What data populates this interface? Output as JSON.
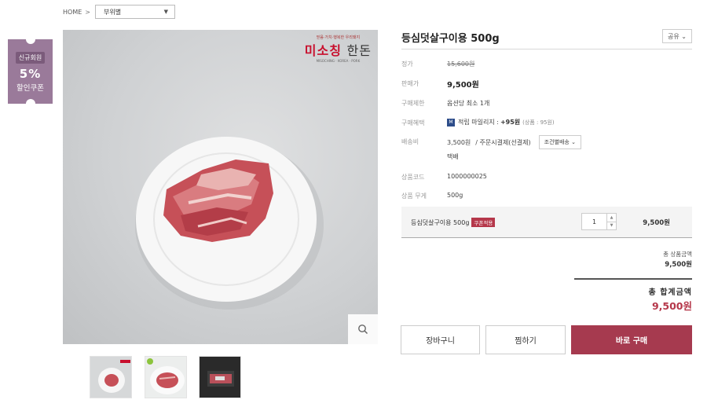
{
  "breadcrumb": {
    "home": "HOME",
    "separator": ">",
    "category": "부위별"
  },
  "coupon": {
    "tag": "신규회원",
    "percent": "5%",
    "text": "할인쿠폰"
  },
  "logo": {
    "small": "믿음·가치·행복한 우리돼지",
    "brand_red": "미소칭",
    "brand_black": "한돈",
    "english": "MISOCHING · KOREA · PORK"
  },
  "product": {
    "title": "등심덧살구이용 500g",
    "share_label": "공유 ⌄",
    "rows": {
      "list_price_label": "정가",
      "list_price": "15,600원",
      "sale_price_label": "판매가",
      "sale_price": "9,500원",
      "limit_label": "구매제한",
      "limit": "옵션당 최소 1개",
      "benefit_label": "구매혜택",
      "benefit_badge": "M",
      "benefit_text": "적립 마일리지 :",
      "benefit_points": "+95원",
      "benefit_note": "(상품 : 95원)",
      "shipping_label": "배송비",
      "shipping_fee": "3,500원",
      "shipping_method": "/ 주문시결제(선결제)",
      "shipping_btn": "조건별배송 ⌄",
      "shipping_type": "택배",
      "code_label": "상품코드",
      "code": "1000000025",
      "weight_label": "상품 무게",
      "weight": "500g"
    },
    "option": {
      "name": "등심덧살구이용 500g",
      "badge": "쿠폰적용",
      "quantity": "1",
      "price": "9,500원"
    },
    "summary": {
      "label": "총 상품금액",
      "value": "9,500원"
    },
    "total": {
      "label": "총 합계금액",
      "value": "9,500원"
    },
    "buttons": {
      "cart": "장바구니",
      "wish": "찜하기",
      "buy": "바로 구매"
    }
  },
  "colors": {
    "accent": "#a63a4f",
    "coupon": "#9a7a9a"
  }
}
